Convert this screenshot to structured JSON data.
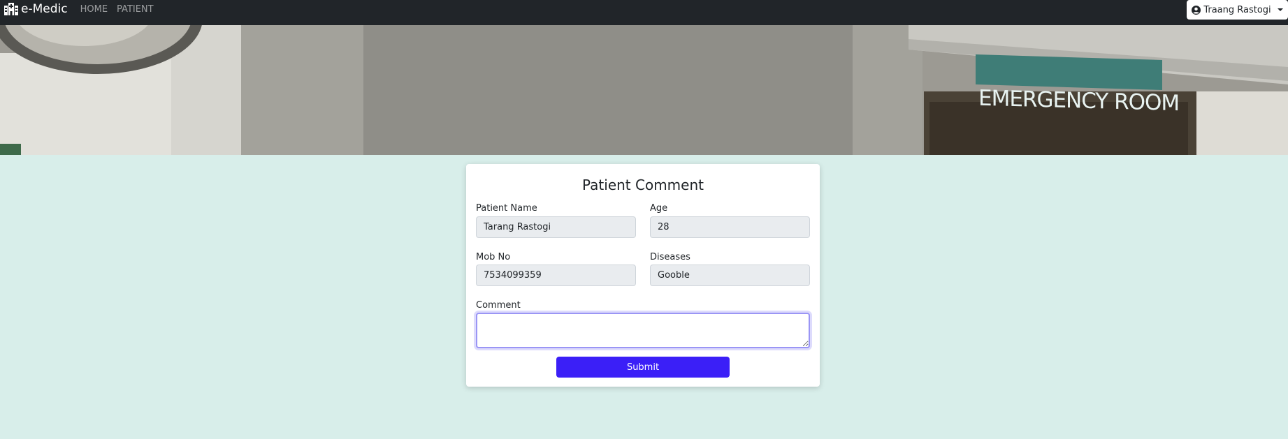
{
  "navbar": {
    "brand": "e-Medic",
    "links": [
      "HOME",
      "PATIENT"
    ],
    "user_label": "Traang Rastogi"
  },
  "hero": {
    "sign_text": "EMERGENCY ROOM"
  },
  "form": {
    "title": "Patient Comment",
    "patient_name_label": "Patient Name",
    "patient_name_value": "Tarang Rastogi",
    "age_label": "Age",
    "age_value": "28",
    "mob_label": "Mob No",
    "mob_value": "7534099359",
    "diseases_label": "Diseases",
    "diseases_value": "Gooble",
    "comment_label": "Comment",
    "comment_value": "",
    "submit_label": "Submit"
  },
  "colors": {
    "navbar_bg": "#212529",
    "page_bg": "#d8eeea",
    "submit_bg": "#3b1ff7"
  }
}
